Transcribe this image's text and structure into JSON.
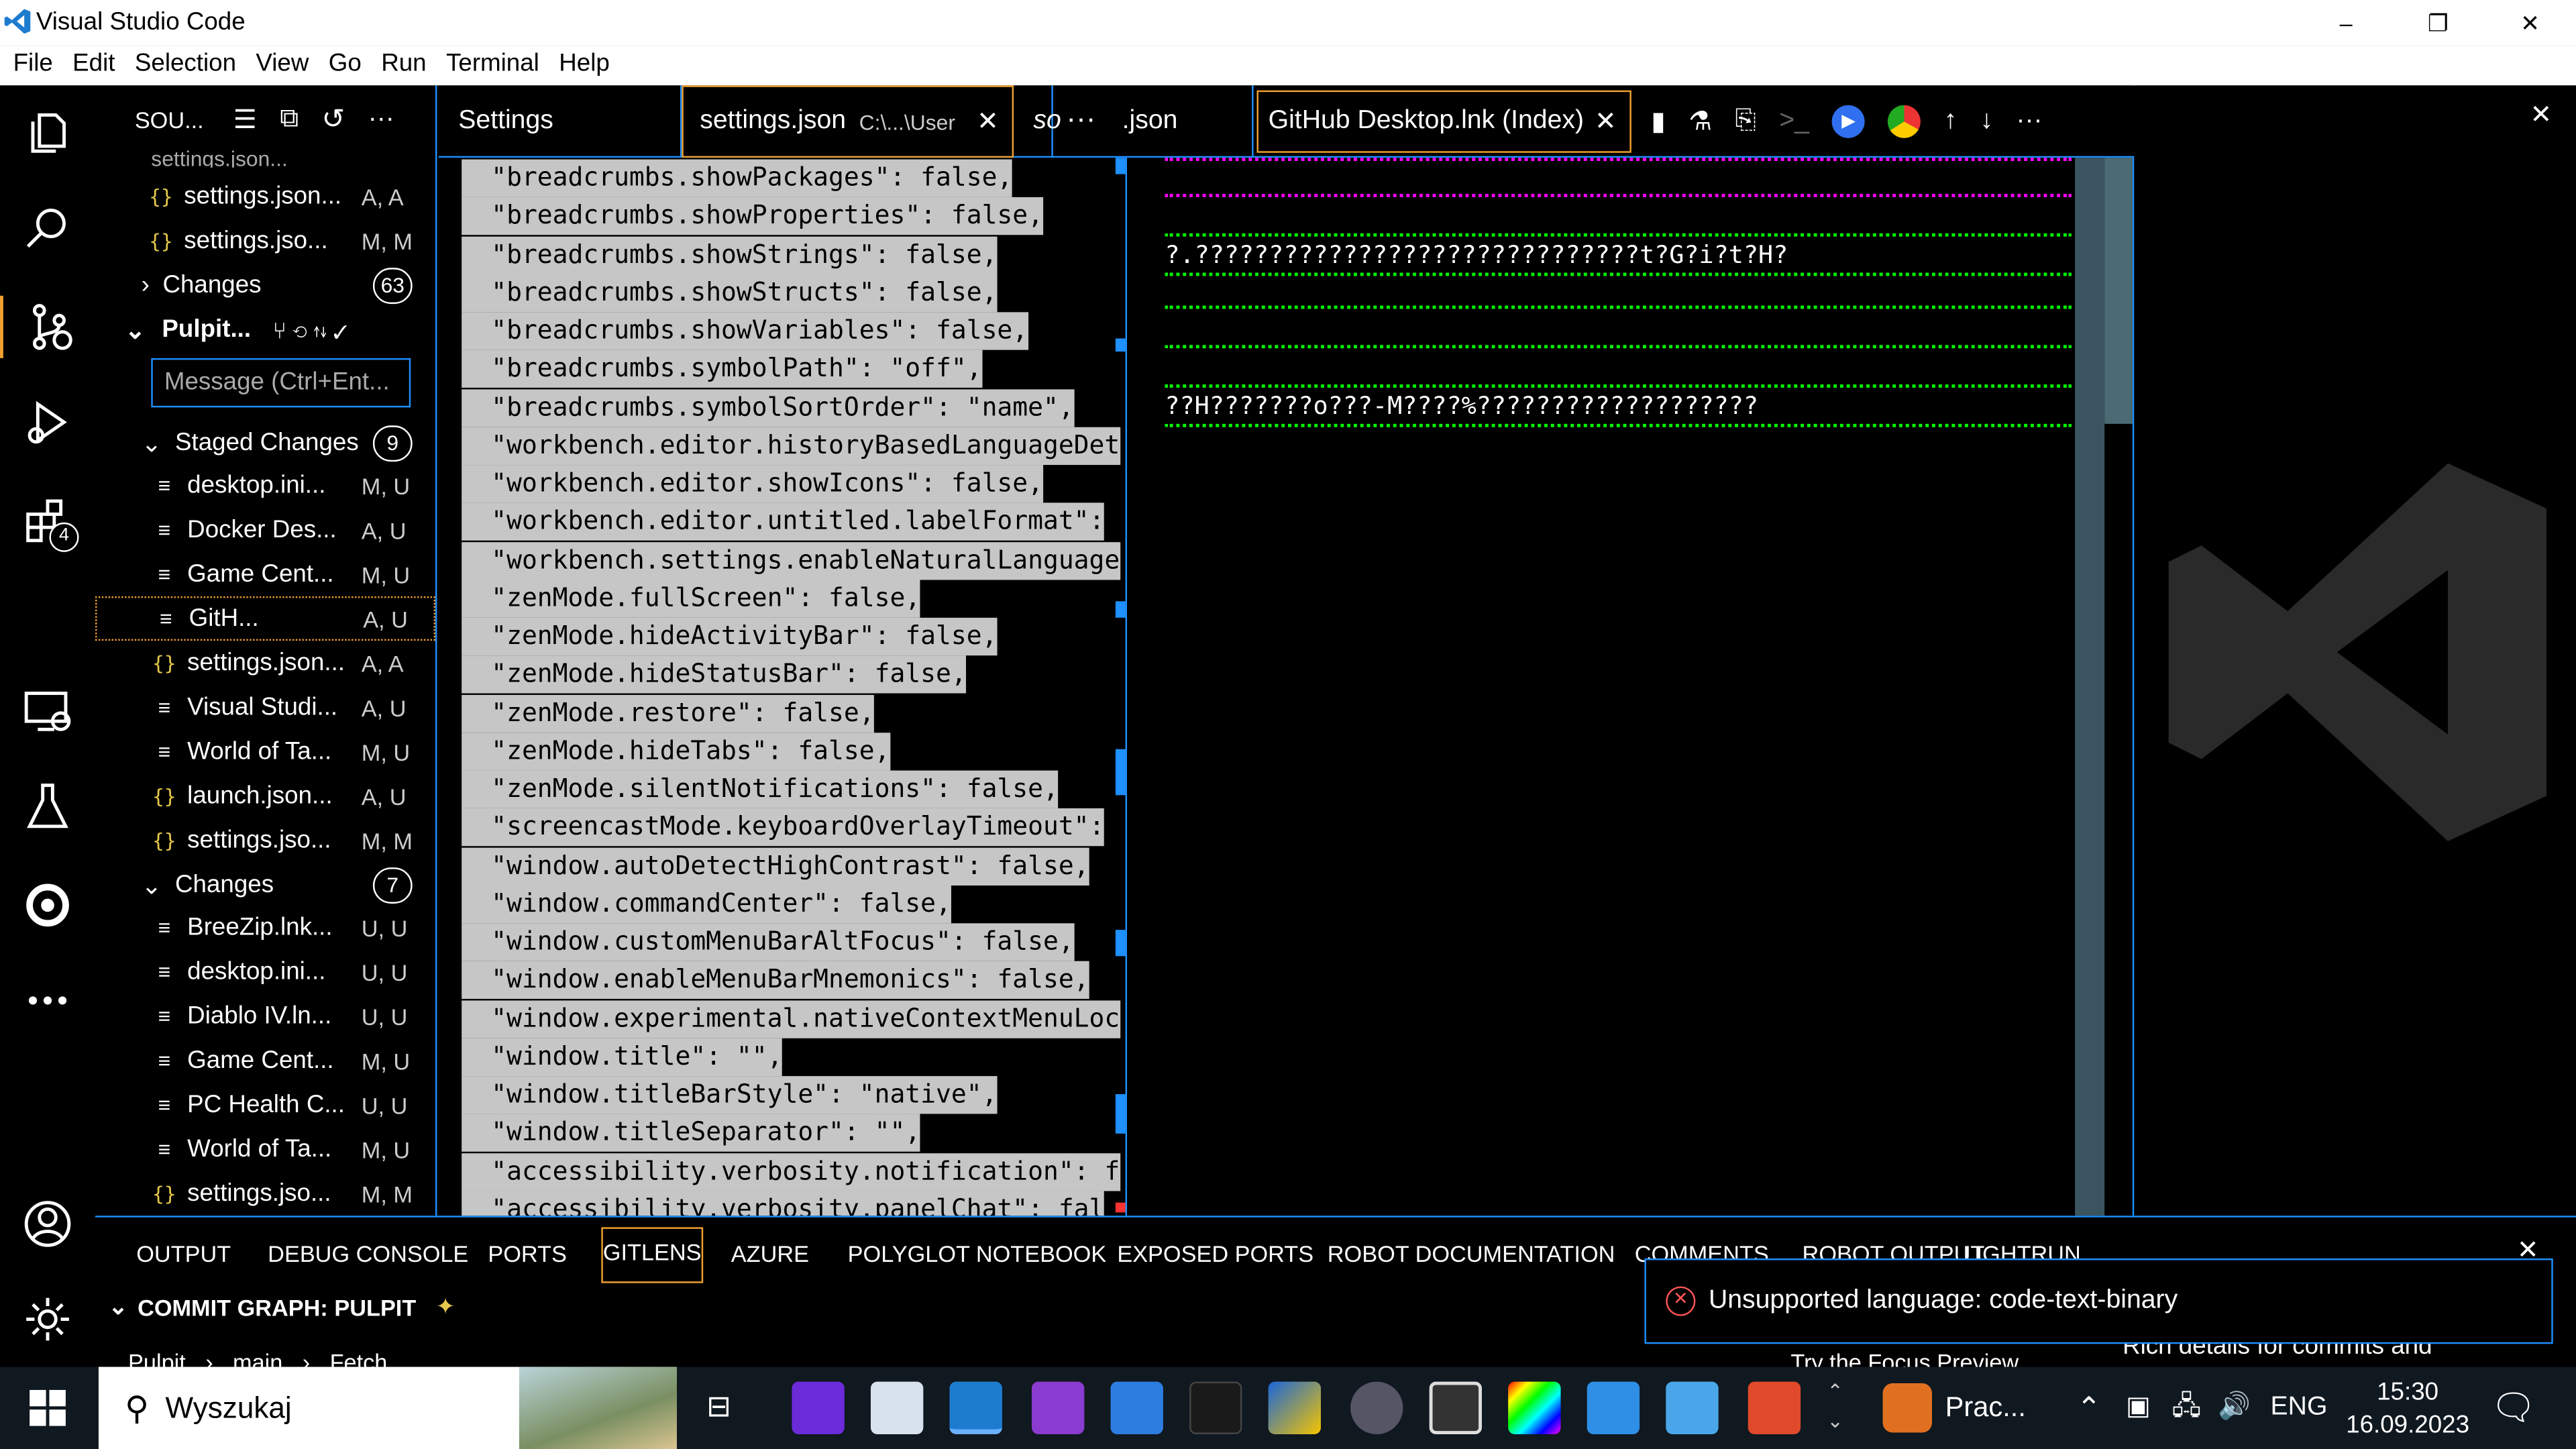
{
  "titlebar": {
    "app_title": "Visual Studio Code",
    "minimize": "–",
    "restore": "❐",
    "close": "✕"
  },
  "menu": [
    "File",
    "Edit",
    "Selection",
    "View",
    "Go",
    "Run",
    "Terminal",
    "Help"
  ],
  "activity_bar": {
    "extensions_badge": "4"
  },
  "sidebar": {
    "header": "SOU...",
    "repo_name": "Pulpit...",
    "message_placeholder": "Message (Ctrl+Ent...",
    "top_items": [
      {
        "name": "settings.json...",
        "status": "A, A",
        "icon": "braces"
      },
      {
        "name": "settings.jso...",
        "status": "M, M",
        "icon": "braces"
      }
    ],
    "changes_top": {
      "label": "Changes",
      "count": "63"
    },
    "staged": {
      "label": "Staged Changes",
      "count": "9",
      "items": [
        {
          "name": "desktop.ini...",
          "status": "M, U",
          "icon": "file"
        },
        {
          "name": "Docker Des...",
          "status": "A, U",
          "icon": "file"
        },
        {
          "name": "Game Cent...",
          "status": "M, U",
          "icon": "file"
        },
        {
          "name": "GitH...",
          "status": "A, U",
          "icon": "file"
        },
        {
          "name": "settings.json...",
          "status": "A, A",
          "icon": "braces"
        },
        {
          "name": "Visual Studi...",
          "status": "A, U",
          "icon": "file"
        },
        {
          "name": "World of Ta...",
          "status": "M, U",
          "icon": "file"
        },
        {
          "name": "launch.json...",
          "status": "A, U",
          "icon": "braces"
        },
        {
          "name": "settings.jso...",
          "status": "M, M",
          "icon": "braces"
        }
      ]
    },
    "changes": {
      "label": "Changes",
      "count": "7",
      "items": [
        {
          "name": "BreeZip.lnk...",
          "status": "U, U",
          "icon": "file"
        },
        {
          "name": "desktop.ini...",
          "status": "U, U",
          "icon": "file"
        },
        {
          "name": "Diablo IV.ln...",
          "status": "U, U",
          "icon": "file"
        },
        {
          "name": "Game Cent...",
          "status": "M, U",
          "icon": "file"
        },
        {
          "name": "PC Health C...",
          "status": "U, U",
          "icon": "file"
        },
        {
          "name": "World of Ta...",
          "status": "M, U",
          "icon": "file"
        },
        {
          "name": "settings.jso...",
          "status": "M, M",
          "icon": "braces"
        }
      ]
    }
  },
  "tabs": {
    "settings": "Settings",
    "settings_json": "settings.json",
    "settings_json_path": "C:\\...\\User",
    "partial_so": "so",
    "partial_json": ".json",
    "github": "GitHub Desktop.lnk (Index)"
  },
  "editor_lines": [
    "\"breadcrumbs.showPackages\": false,",
    "\"breadcrumbs.showProperties\": false,",
    "\"breadcrumbs.showStrings\": false,",
    "\"breadcrumbs.showStructs\": false,",
    "\"breadcrumbs.showVariables\": false,",
    "\"breadcrumbs.symbolPath\": \"off\",",
    "\"breadcrumbs.symbolSortOrder\": \"name\",",
    "\"workbench.editor.historyBasedLanguageDet",
    "\"workbench.editor.showIcons\": false,",
    "\"workbench.editor.untitled.labelFormat\":",
    "\"workbench.settings.enableNaturalLanguage",
    "\"zenMode.fullScreen\": false,",
    "\"zenMode.hideActivityBar\": false,",
    "\"zenMode.hideStatusBar\": false,",
    "\"zenMode.restore\": false,",
    "\"zenMode.hideTabs\": false,",
    "\"zenMode.silentNotifications\": false,",
    "\"screencastMode.keyboardOverlayTimeout\":",
    "\"window.autoDetectHighContrast\": false,",
    "\"window.commandCenter\": false,",
    "\"window.customMenuBarAltFocus\": false,",
    "\"window.enableMenuBarMnemonics\": false,",
    "\"window.experimental.nativeContextMenuLoc",
    "\"window.title\": \"\",",
    "\"window.titleBarStyle\": \"native\",",
    "\"window.titleSeparator\": \"\",",
    "\"accessibility.verbosity.notification\": f",
    "\"accessibility.verbosity.panelChat\": fal"
  ],
  "binary_lines": [
    "?.??????????????????????????????t?G?i?t?H?",
    "??H???????o???-M????%???????????????????"
  ],
  "panel": {
    "tabs": [
      "OUTPUT",
      "DEBUG CONSOLE",
      "PORTS",
      "GITLENS",
      "AZURE",
      "POLYGLOT NOTEBOOK",
      "EXPOSED PORTS",
      "ROBOT DOCUMENTATION",
      "COMMENTS",
      "ROBOT OUTPUT",
      "LIGHTRUN"
    ],
    "commit_graph": "COMMIT GRAPH: PULPIT",
    "branch": "Pulpit",
    "branch2": "main",
    "fetch": "Fetch",
    "focus_preview": "Try the Focus Preview",
    "rich_details": "Rich details for commits and"
  },
  "notification": {
    "message": "Unsupported language: code-text-binary"
  },
  "taskbar": {
    "search_placeholder": "Wyszukaj",
    "weather_text": "Prac...",
    "language": "ENG",
    "time": "15:30",
    "date": "16.09.2023"
  },
  "colors": {
    "accent": "#1e90ff",
    "orange": "#f0a030",
    "green_highlight": "#00ff00",
    "magenta": "#ff00ff"
  }
}
